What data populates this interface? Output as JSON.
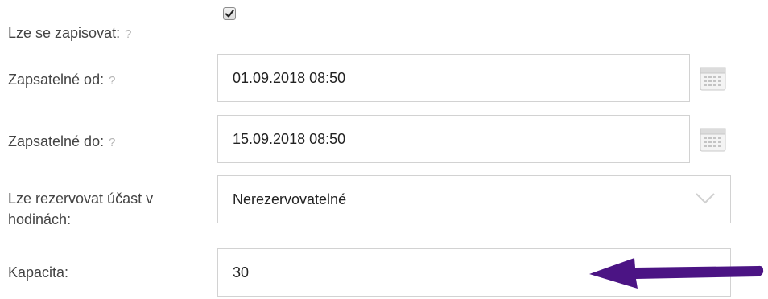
{
  "form": {
    "enroll_allowed": {
      "label": "Lze se zapisovat:",
      "help": "?",
      "checked": true
    },
    "enroll_from": {
      "label": "Zapsatelné od:",
      "help": "?",
      "value": "01.09.2018 08:50",
      "icon": "calendar-icon"
    },
    "enroll_to": {
      "label": "Zapsatelné do:",
      "help": "?",
      "value": "15.09.2018 08:50",
      "icon": "calendar-icon"
    },
    "reserve_hours": {
      "label_line1": "Lze rezervovat účast v",
      "label_line2": "hodinách:",
      "value": "Nerezervovatelné",
      "icon": "chevron-down-icon"
    },
    "capacity": {
      "label": "Kapacita:",
      "value": "30"
    }
  },
  "annotation": {
    "icon": "arrow-left-icon",
    "color": "#4b1484"
  }
}
